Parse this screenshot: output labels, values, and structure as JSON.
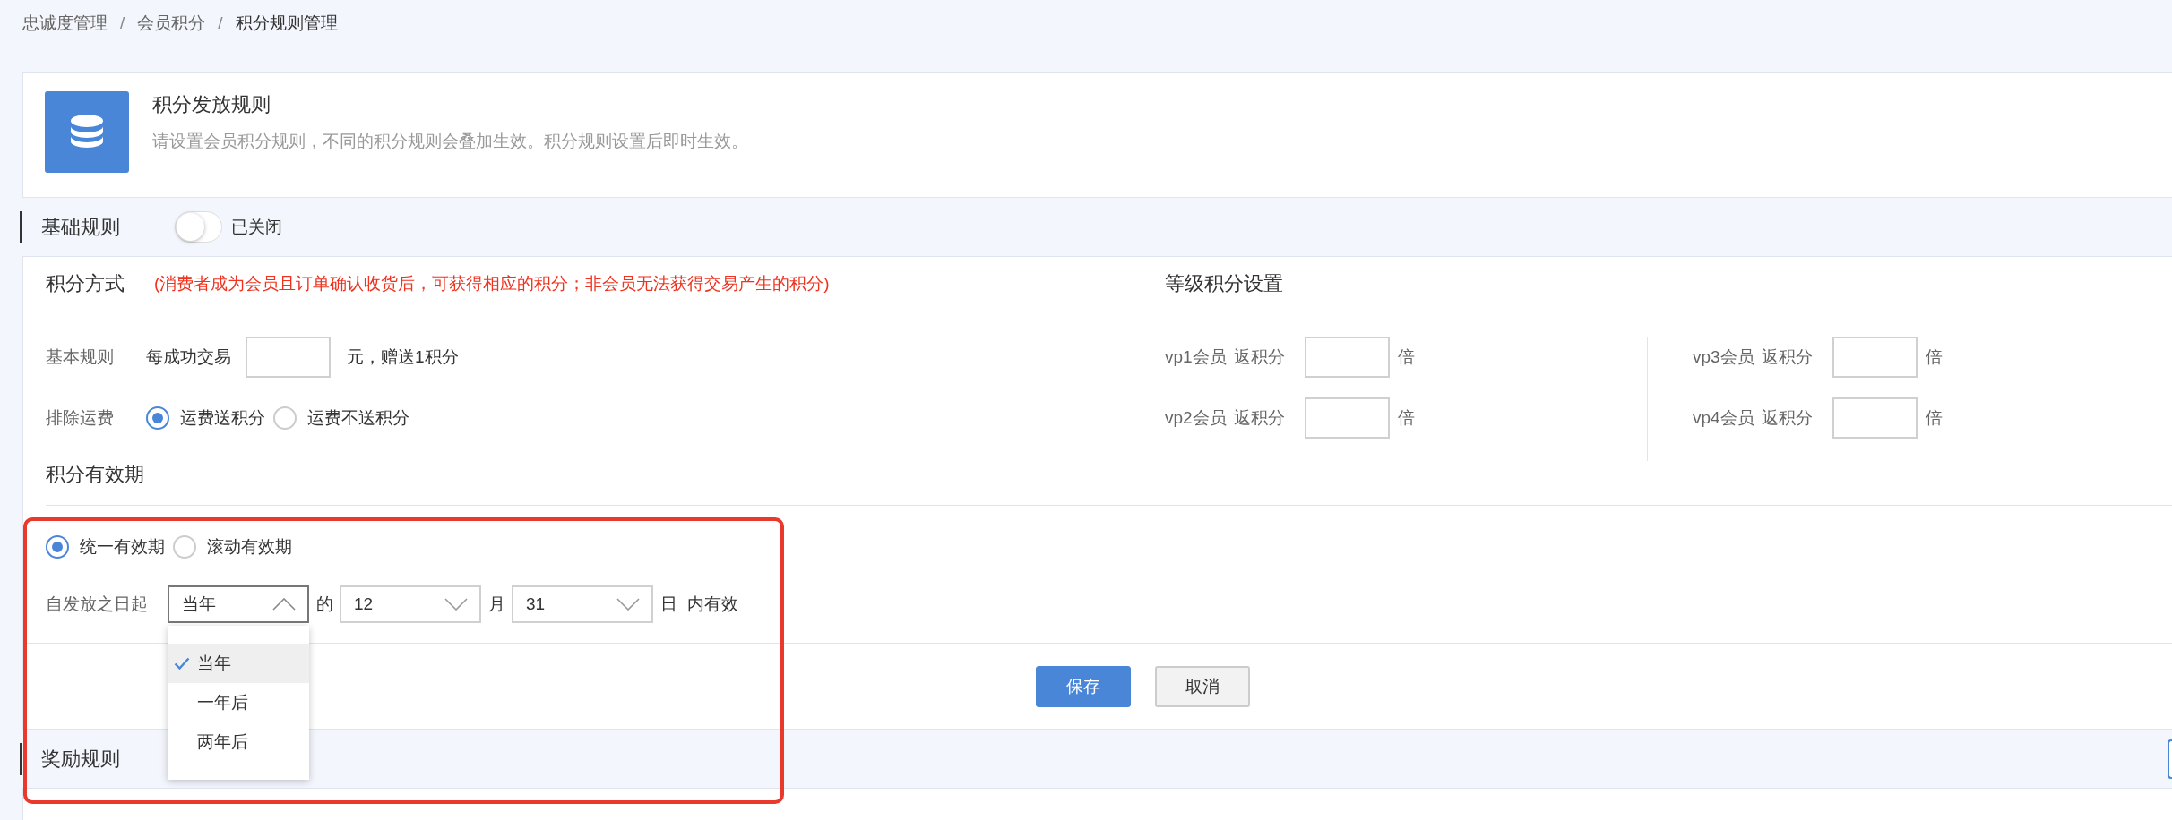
{
  "breadcrumb": [
    {
      "label": "忠诚度管理",
      "current": false,
      "separator": "/"
    },
    {
      "label": "会员积分",
      "current": false,
      "separator": "/"
    },
    {
      "label": "积分规则管理",
      "current": true
    }
  ],
  "header": {
    "title": "积分发放规则",
    "description": "请设置会员积分规则，不同的积分规则会叠加生效。积分规则设置后即时生效。"
  },
  "basic_rules": {
    "title": "基础规则",
    "toggle": {
      "on": false,
      "label": "已关闭"
    },
    "points_method": {
      "title": "积分方式",
      "note": "(消费者成为会员且订单确认收货后，可获得相应的积分；非会员无法获得交易产生的积分)",
      "base_rule": {
        "label": "基本规则",
        "prefix": "每成功交易",
        "suffix": "元，赠送1积分"
      },
      "shipping": {
        "label": "排除运费",
        "options": [
          {
            "label": "运费送积分",
            "selected": true
          },
          {
            "label": "运费不送积分",
            "selected": false
          }
        ]
      }
    },
    "level_points": {
      "title": "等级积分设置",
      "columns": [
        {
          "levels": [
            {
              "member": "vp1会员",
              "label": "返积分",
              "unit": "倍"
            },
            {
              "member": "vp2会员",
              "label": "返积分",
              "unit": "倍"
            }
          ]
        },
        {
          "levels": [
            {
              "member": "vp3会员",
              "label": "返积分",
              "unit": "倍"
            },
            {
              "member": "vp4会员",
              "label": "返积分",
              "unit": "倍"
            }
          ]
        }
      ]
    },
    "validity": {
      "title": "积分有效期",
      "highlighted": true,
      "modes": [
        {
          "label": "统一有效期",
          "selected": true
        },
        {
          "label": "滚动有效期",
          "selected": false
        }
      ],
      "start_label": "自发放之日起",
      "selects": [
        {
          "value": "当年",
          "expanded": true,
          "after": "的",
          "options": [
            {
              "label": "当年",
              "selected": true
            },
            {
              "label": "一年后",
              "selected": false
            },
            {
              "label": "两年后",
              "selected": false
            }
          ]
        },
        {
          "value": "12",
          "expanded": false,
          "after": "月"
        },
        {
          "value": "31",
          "expanded": false,
          "after": "日"
        }
      ],
      "end_label": "内有效"
    },
    "actions": [
      {
        "label": "保存",
        "kind": "primary"
      },
      {
        "label": "取消",
        "kind": "secondary"
      }
    ]
  },
  "reward_rules": {
    "title": "奖励规则"
  }
}
